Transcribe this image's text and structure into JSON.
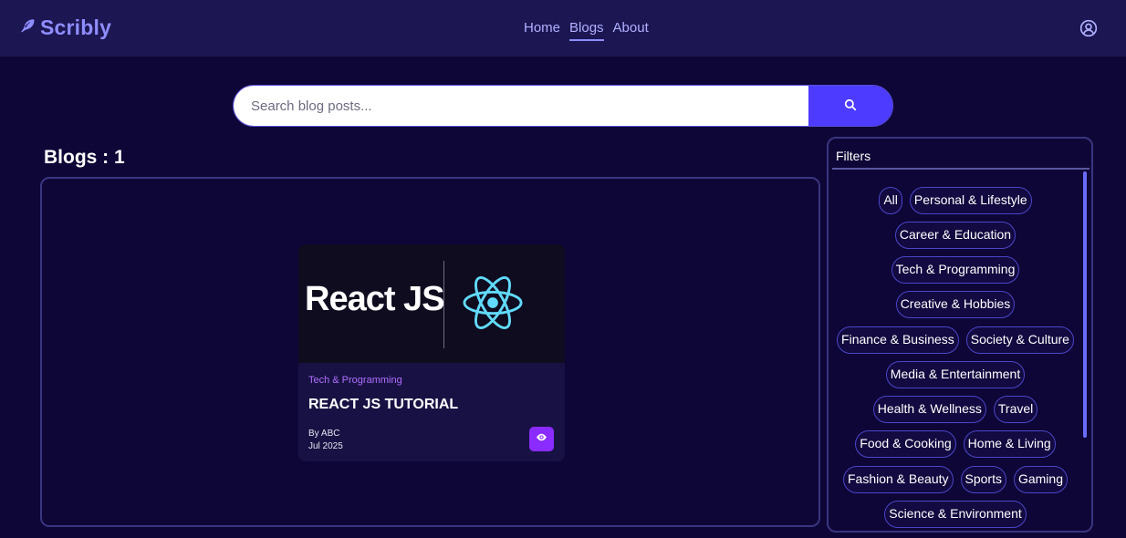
{
  "app": {
    "brand": "Scribly"
  },
  "nav": {
    "links": [
      "Home",
      "Blogs",
      "About"
    ],
    "active": "Blogs"
  },
  "search": {
    "placeholder": "Search blog posts..."
  },
  "blogs": {
    "heading": "Blogs : 1",
    "cards": [
      {
        "thumbnail_text": "React JS",
        "category": "Tech & Programming",
        "title": "REACT JS TUTORIAL",
        "author": "By ABC",
        "date": "Jul 2025"
      }
    ]
  },
  "filters": {
    "title": "Filters",
    "rows": [
      [
        "All",
        "Personal & Lifestyle"
      ],
      [
        "Career & Education"
      ],
      [
        "Tech & Programming"
      ],
      [
        "Creative & Hobbies"
      ],
      [
        "Finance & Business",
        "Society & Culture"
      ],
      [
        "Media & Entertainment"
      ],
      [
        "Health & Wellness",
        "Travel"
      ],
      [
        "Food & Cooking",
        "Home & Living"
      ],
      [
        "Fashion & Beauty",
        "Sports",
        "Gaming"
      ],
      [
        "Science & Environment"
      ]
    ]
  },
  "colors": {
    "background": "#0e0636",
    "navbar": "#1c1652",
    "accent": "#4d3bff",
    "brand": "#8f8dff",
    "card_category": "#b06fff",
    "view_button": "#8a2bff"
  },
  "icons": {
    "brand": "feather-pen-icon",
    "user": "user-circle-icon",
    "search": "search-icon",
    "view": "eye-icon",
    "thumbnail_logo": "react-logo-icon"
  }
}
